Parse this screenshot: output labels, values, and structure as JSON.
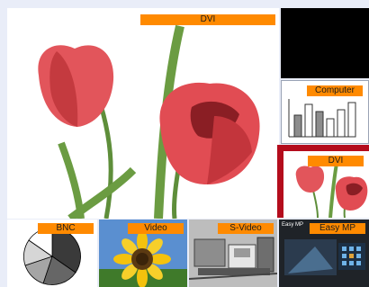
{
  "main_view": {
    "label": "DVI"
  },
  "sources": {
    "computer": {
      "label": "Computer"
    },
    "dvi": {
      "label": "DVI",
      "selected": true,
      "highlight_color": "#b40c1c"
    },
    "bnc": {
      "label": "BNC"
    },
    "video": {
      "label": "Video"
    },
    "svideo": {
      "label": "S-Video"
    },
    "easymp": {
      "label": "Easy MP",
      "title_text": "Easy MP"
    }
  },
  "colors": {
    "label_bg": "#ff8a00",
    "background": "#e9edf8"
  }
}
